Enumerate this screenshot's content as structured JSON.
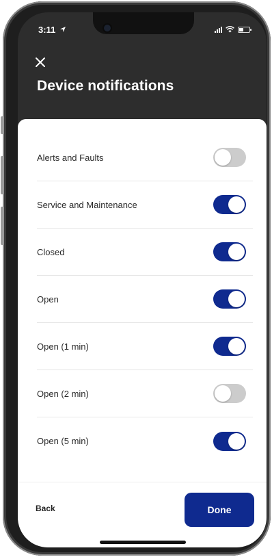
{
  "status_bar": {
    "time": "3:11"
  },
  "header": {
    "title": "Device notifications"
  },
  "notifications": [
    {
      "label": "Alerts and Faults",
      "enabled": false
    },
    {
      "label": "Service and Maintenance",
      "enabled": true
    },
    {
      "label": "Closed",
      "enabled": true
    },
    {
      "label": "Open",
      "enabled": true
    },
    {
      "label": "Open (1 min)",
      "enabled": true
    },
    {
      "label": "Open (2 min)",
      "enabled": false
    },
    {
      "label": "Open (5 min)",
      "enabled": true
    }
  ],
  "footer": {
    "back_label": "Back",
    "done_label": "Done"
  },
  "colors": {
    "accent": "#0f2a8f",
    "toggle_off": "#cccccc",
    "header_bg": "#2d2d2d"
  }
}
